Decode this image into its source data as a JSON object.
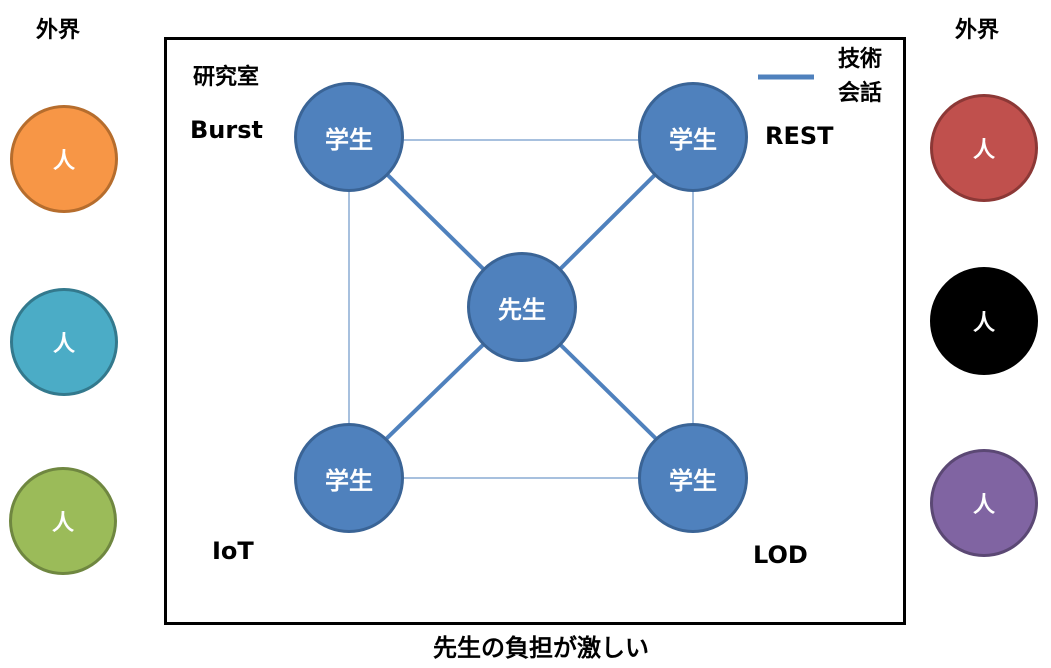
{
  "outside_left": {
    "label": "外界"
  },
  "outside_right": {
    "label": "外界"
  },
  "people": {
    "left": [
      {
        "label": "人",
        "color": "#f79646",
        "border": "#b66d2d"
      },
      {
        "label": "人",
        "color": "#4bacc6",
        "border": "#33798d"
      },
      {
        "label": "人",
        "color": "#9bbb59",
        "border": "#6f8740"
      }
    ],
    "right": [
      {
        "label": "人",
        "color": "#c0504d",
        "border": "#8c3836"
      },
      {
        "label": "人",
        "color": "#000000",
        "border": "#000000"
      },
      {
        "label": "人",
        "color": "#8064a2",
        "border": "#5b4874"
      }
    ]
  },
  "room": {
    "title": "研究室",
    "legend": {
      "line1": "技術",
      "line2": "会話",
      "line_color": "#4f81bd"
    },
    "corners": {
      "top_left": "Burst",
      "top_right": "REST",
      "bottom_left": "IoT",
      "bottom_right": "LOD"
    },
    "nodes": {
      "teacher": "先生",
      "student_tl": "学生",
      "student_tr": "学生",
      "student_bl": "学生",
      "student_br": "学生"
    }
  },
  "caption": "先生の負担が激しい"
}
